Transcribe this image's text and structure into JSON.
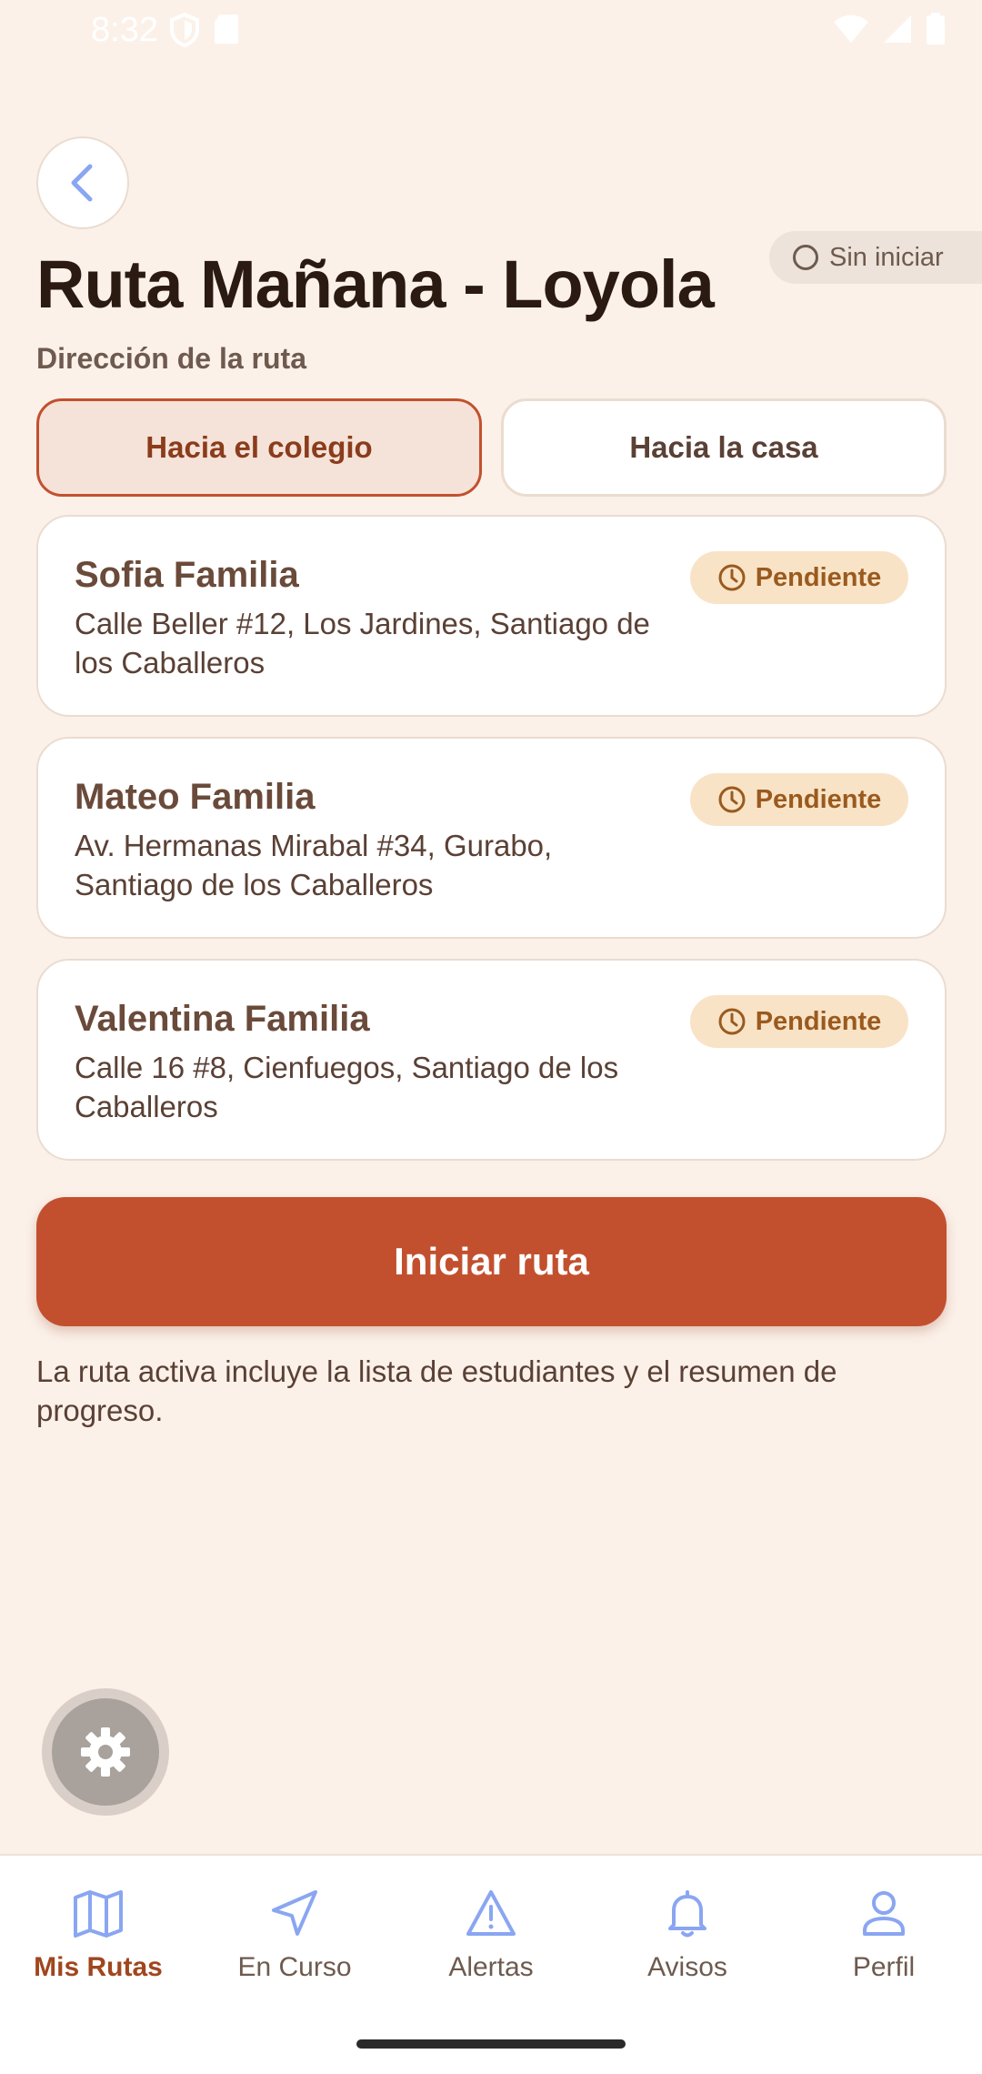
{
  "status_bar": {
    "time": "8:32"
  },
  "header": {
    "title": "Ruta Mañana - Loyola",
    "status_chip": "Sin iniciar",
    "section_label": "Dirección de la ruta"
  },
  "direction": {
    "to_school": "Hacia el colegio",
    "to_home": "Hacia la casa",
    "selected": "Hacia el colegio"
  },
  "students": [
    {
      "name": "Sofia Familia",
      "address": "Calle Beller #12, Los Jardines, Santiago de los Caballeros",
      "status": "Pendiente"
    },
    {
      "name": "Mateo Familia",
      "address": "Av. Hermanas Mirabal #34, Gurabo, Santiago de los Caballeros",
      "status": "Pendiente"
    },
    {
      "name": "Valentina Familia",
      "address": "Calle 16 #8, Cienfuegos, Santiago de los Caballeros",
      "status": "Pendiente"
    }
  ],
  "actions": {
    "start_route": "Iniciar ruta"
  },
  "info": "La ruta activa incluye la lista de estudiantes y el resumen de progreso.",
  "bottom_nav": [
    {
      "label": "Mis Rutas",
      "icon": "map-icon",
      "active": true
    },
    {
      "label": "En Curso",
      "icon": "navigation-icon",
      "active": false
    },
    {
      "label": "Alertas",
      "icon": "warning-icon",
      "active": false
    },
    {
      "label": "Avisos",
      "icon": "bell-icon",
      "active": false
    },
    {
      "label": "Perfil",
      "icon": "user-icon",
      "active": false
    }
  ],
  "colors": {
    "background": "#FBF1E9",
    "primary": "#C2502E",
    "active_nav": "#A0461E",
    "nav_icon": "#8AA6F2",
    "pending_badge": "#F9E3C7"
  }
}
